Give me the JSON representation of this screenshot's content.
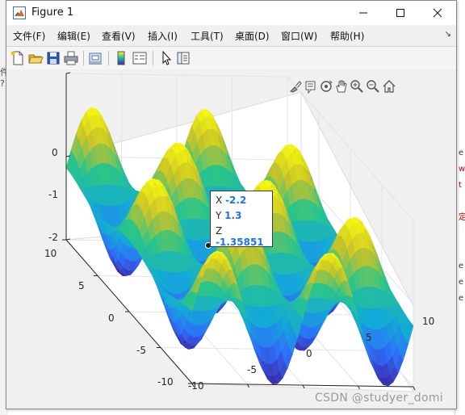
{
  "window": {
    "title": "Figure 1"
  },
  "menu": [
    "文件(F)",
    "编辑(E)",
    "查看(V)",
    "插入(I)",
    "工具(T)",
    "桌面(D)",
    "窗口(W)",
    "帮助(H)"
  ],
  "toolbar": [
    "new-figure-icon",
    "open-icon",
    "save-icon",
    "print-icon",
    "link-figure-icon",
    "colorbar-icon",
    "legend-icon",
    "edit-plot-icon",
    "property-inspector-icon"
  ],
  "axes_toolbar": [
    "brush-icon",
    "data-tips-icon",
    "rotate-icon",
    "pan-icon",
    "zoom-in-icon",
    "zoom-out-icon",
    "home-icon"
  ],
  "chart_data": {
    "type": "surface",
    "title": "",
    "z_ticks": [
      "0",
      "-1",
      "-2"
    ],
    "y_ticks": [
      "10",
      "5",
      "0",
      "-5",
      "-10"
    ],
    "x_ticks": [
      "-10",
      "-5",
      "0",
      "5",
      "10"
    ],
    "xlim": [
      -10,
      10
    ],
    "ylim": [
      -10,
      10
    ],
    "zlim": [
      -2,
      0
    ],
    "grid": true,
    "colormap": "parula",
    "datatip": {
      "x_label": "X",
      "x_value": "-2.2",
      "y_label": "Y",
      "y_value": "1.3",
      "z_label": "Z",
      "z_value": "-1.35851"
    }
  },
  "background": {
    "left_chars": [
      "件",
      "?"
    ],
    "right_chars": [
      "e",
      "w",
      "t",
      "定",
      "e",
      "e",
      "e"
    ]
  },
  "watermark": "CSDN @studyer_domi"
}
